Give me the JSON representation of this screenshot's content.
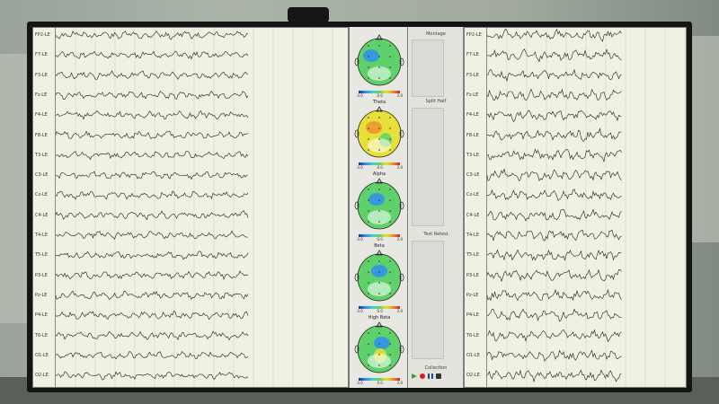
{
  "eeg_left": {
    "channels": [
      "FP2-LE",
      "F7-LE",
      "F3-LE",
      "Fz-LE",
      "F4-LE",
      "F8-LE",
      "T3-LE",
      "C3-LE",
      "Cz-LE",
      "C4-LE",
      "T4-LE",
      "T5-LE",
      "P3-LE",
      "Pz-LE",
      "P4-LE",
      "T6-LE",
      "O1-LE",
      "O2-LE"
    ]
  },
  "eeg_right": {
    "channels": [
      "FP2-LE",
      "F7-LE",
      "F3-LE",
      "Fz-LE",
      "F4-LE",
      "F8-LE",
      "T3-LE",
      "C3-LE",
      "Cz-LE",
      "C4-LE",
      "T4-LE",
      "T5-LE",
      "P3-LE",
      "Pz-LE",
      "P4-LE",
      "T6-LE",
      "O1-LE",
      "O2-LE"
    ]
  },
  "topomaps": [
    {
      "title": "",
      "scale": [
        "-3.0",
        "0.0",
        "3.0"
      ]
    },
    {
      "title": "Theta",
      "scale": [
        "-3.0",
        "0.0",
        "3.0"
      ]
    },
    {
      "title": "Alpha",
      "scale": [
        "-3.0",
        "0.0",
        "3.0"
      ]
    },
    {
      "title": "Beta",
      "scale": [
        "-3.0",
        "0.0",
        "3.0"
      ]
    },
    {
      "title": "High Beta",
      "scale": [
        "-3.0",
        "0.0",
        "3.0"
      ]
    }
  ],
  "controls": {
    "montage_label": "Montage",
    "split_half_label": "Split Half",
    "test_retest_label": "Test Retest",
    "collection_label": "Collection"
  },
  "colors": {
    "trace": "#1a1a1a",
    "gridline": "#c8c8bc",
    "map_green": "#5fd16a",
    "map_blue": "#2f8ff0",
    "map_yellow": "#e8e03a",
    "map_orange": "#f0902a"
  }
}
